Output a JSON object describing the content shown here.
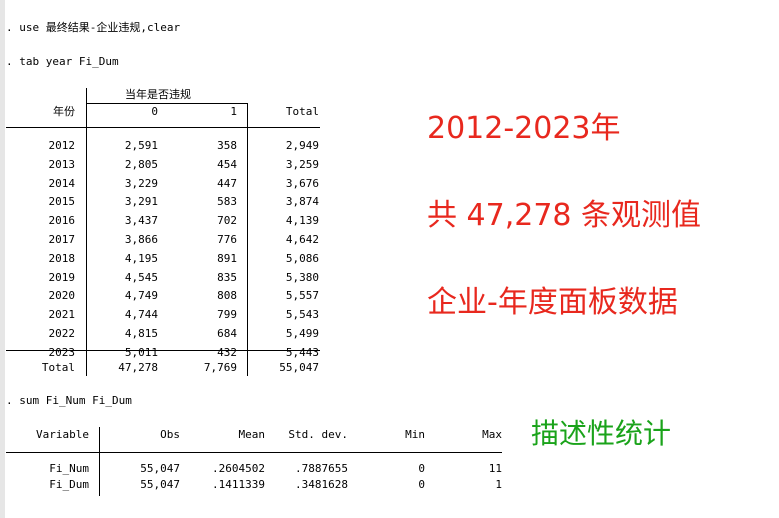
{
  "commands": {
    "use": ". use 最终结果-企业违规,clear",
    "tab": ". tab year Fi_Dum",
    "sum": ". sum Fi_Num Fi_Dum"
  },
  "tab": {
    "super_header": "当年是否违规",
    "headers": [
      "年份",
      "0",
      "1",
      "Total"
    ],
    "rows": [
      [
        "2012",
        "2,591",
        "358",
        "2,949"
      ],
      [
        "2013",
        "2,805",
        "454",
        "3,259"
      ],
      [
        "2014",
        "3,229",
        "447",
        "3,676"
      ],
      [
        "2015",
        "3,291",
        "583",
        "3,874"
      ],
      [
        "2016",
        "3,437",
        "702",
        "4,139"
      ],
      [
        "2017",
        "3,866",
        "776",
        "4,642"
      ],
      [
        "2018",
        "4,195",
        "891",
        "5,086"
      ],
      [
        "2019",
        "4,545",
        "835",
        "5,380"
      ],
      [
        "2020",
        "4,749",
        "808",
        "5,557"
      ],
      [
        "2021",
        "4,744",
        "799",
        "5,543"
      ],
      [
        "2022",
        "4,815",
        "684",
        "5,499"
      ],
      [
        "2023",
        "5,011",
        "432",
        "5,443"
      ]
    ],
    "total": [
      "Total",
      "47,278",
      "7,769",
      "55,047"
    ]
  },
  "sum": {
    "headers": [
      "Variable",
      "Obs",
      "Mean",
      "Std. dev.",
      "Min",
      "Max"
    ],
    "rows": [
      [
        "Fi_Num",
        "55,047",
        ".2604502",
        ".7887655",
        "0",
        "11"
      ],
      [
        "Fi_Dum",
        "55,047",
        ".1411339",
        ".3481628",
        "0",
        "1"
      ]
    ]
  },
  "annotations": {
    "years": "2012-2023年",
    "obs": "共 47,278 条观测值",
    "panel": "企业-年度面板数据",
    "desc": "描述性统计"
  },
  "colors": {
    "red": "#e8281e",
    "green": "#1aa31a"
  }
}
